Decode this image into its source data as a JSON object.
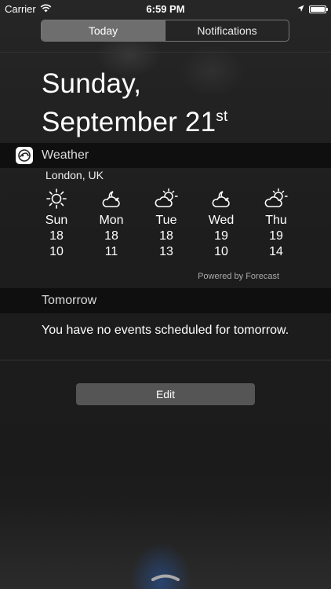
{
  "status_bar": {
    "carrier": "Carrier",
    "time": "6:59 PM",
    "battery_level": 1.0
  },
  "segments": [
    {
      "label": "Today",
      "active": true
    },
    {
      "label": "Notifications",
      "active": false
    }
  ],
  "date": {
    "line1": "Sunday,",
    "line2": "September 21",
    "suffix": "st"
  },
  "weather": {
    "title": "Weather",
    "location": "London, UK",
    "days": [
      {
        "name": "Sun",
        "high": "18",
        "low": "10",
        "icon": "sun-icon"
      },
      {
        "name": "Mon",
        "high": "18",
        "low": "11",
        "icon": "cloudy-night-icon"
      },
      {
        "name": "Tue",
        "high": "18",
        "low": "13",
        "icon": "partly-cloudy-icon"
      },
      {
        "name": "Wed",
        "high": "19",
        "low": "10",
        "icon": "cloudy-night-icon"
      },
      {
        "name": "Thu",
        "high": "19",
        "low": "14",
        "icon": "partly-cloudy-icon"
      }
    ],
    "powered_by": "Powered by Forecast"
  },
  "tomorrow": {
    "title": "Tomorrow",
    "message": "You have no events scheduled for tomorrow."
  },
  "edit_label": "Edit",
  "colors": {
    "header_bg": "#0f0f0f",
    "active_segment": "#6e6e6e",
    "edit_button": "#555555"
  }
}
